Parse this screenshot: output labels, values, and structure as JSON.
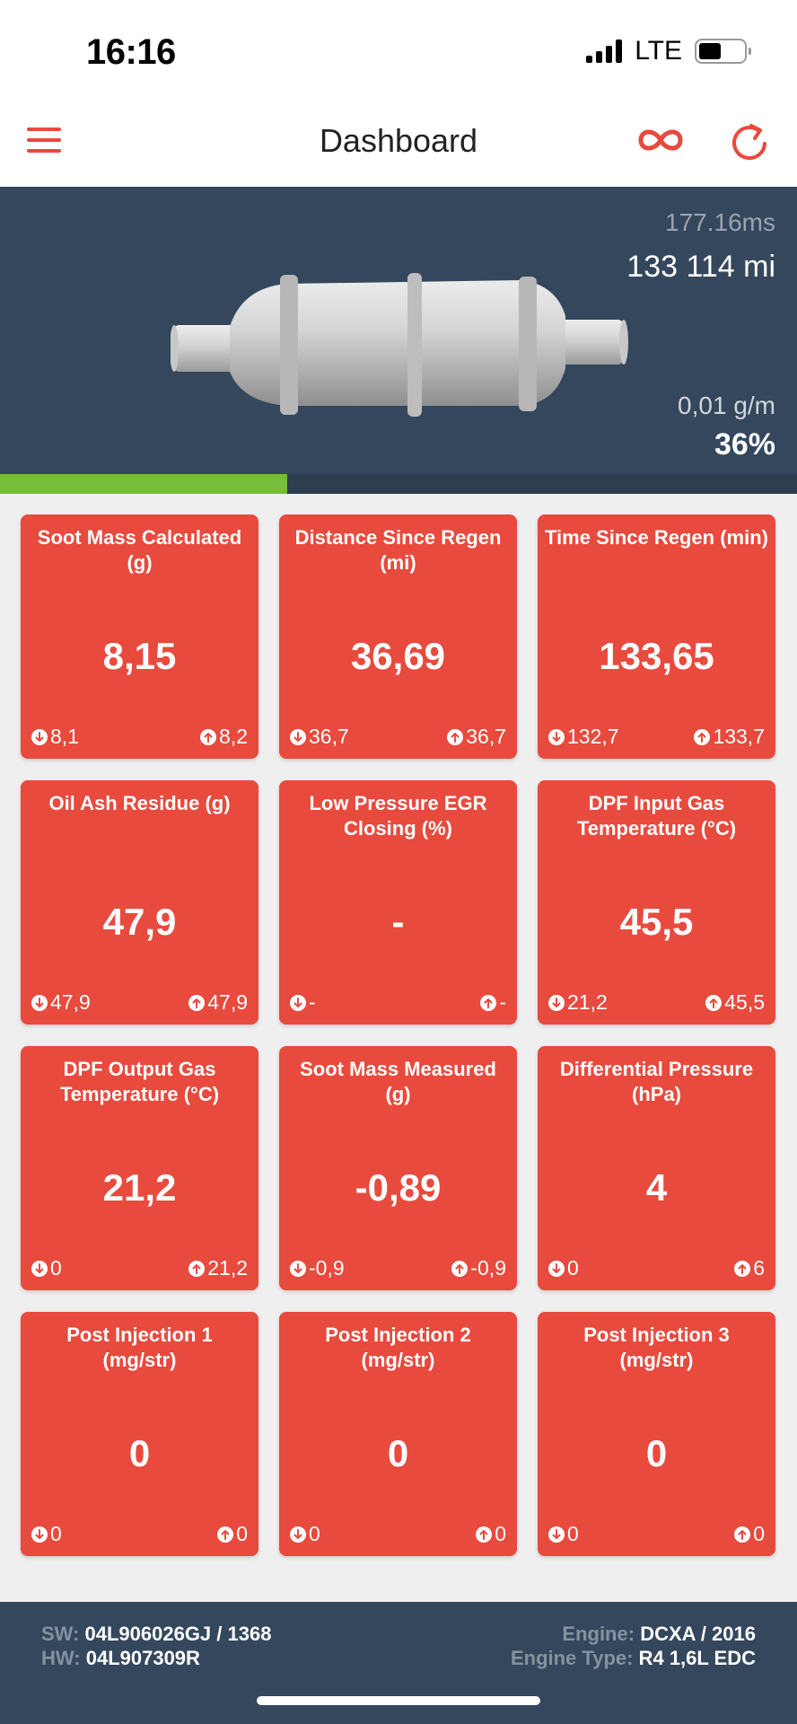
{
  "status": {
    "time": "16:16",
    "network": "LTE"
  },
  "nav": {
    "title": "Dashboard"
  },
  "colors": {
    "accent": "#e84a3d",
    "panel": "#34475c",
    "progress": "#76bd3a",
    "background": "#efefef"
  },
  "icons": {
    "menu": "hamburger-icon",
    "link": "infinity-icon",
    "refresh": "refresh-icon",
    "min": "arrow-down-circle-icon",
    "max": "arrow-up-circle-icon"
  },
  "hero": {
    "latency": "177.16ms",
    "odometer": "133 114 mi",
    "rate": "0,01 g/m",
    "percent": "36%",
    "percent_value": 36
  },
  "cards": [
    {
      "title": "Soot Mass Calculated (g)",
      "value": "8,15",
      "min": "8,1",
      "max": "8,2"
    },
    {
      "title": "Distance Since Regen (mi)",
      "value": "36,69",
      "min": "36,7",
      "max": "36,7"
    },
    {
      "title": "Time Since Regen (min)",
      "value": "133,65",
      "min": "132,7",
      "max": "133,7"
    },
    {
      "title": "Oil Ash Residue (g)",
      "value": "47,9",
      "min": "47,9",
      "max": "47,9"
    },
    {
      "title": "Low Pressure EGR Closing (%)",
      "value": "-",
      "min": "-",
      "max": "-"
    },
    {
      "title": "DPF Input Gas Temperature (°C)",
      "value": "45,5",
      "min": "21,2",
      "max": "45,5"
    },
    {
      "title": "DPF Output Gas Temperature (°C)",
      "value": "21,2",
      "min": "0",
      "max": "21,2"
    },
    {
      "title": "Soot Mass Measured (g)",
      "value": "-0,89",
      "min": "-0,9",
      "max": "-0,9"
    },
    {
      "title": "Differential Pressure (hPa)",
      "value": "4",
      "min": "0",
      "max": "6"
    },
    {
      "title": "Post Injection 1 (mg/str)",
      "value": "0",
      "min": "0",
      "max": "0"
    },
    {
      "title": "Post Injection 2 (mg/str)",
      "value": "0",
      "min": "0",
      "max": "0"
    },
    {
      "title": "Post Injection 3 (mg/str)",
      "value": "0",
      "min": "0",
      "max": "0"
    }
  ],
  "footer": {
    "sw_label": "SW:",
    "sw_value": "04L906026GJ / 1368",
    "hw_label": "HW:",
    "hw_value": "04L907309R",
    "engine_label": "Engine:",
    "engine_value": "DCXA / 2016",
    "engine_type_label": "Engine Type:",
    "engine_type_value": "R4 1,6L EDC"
  }
}
